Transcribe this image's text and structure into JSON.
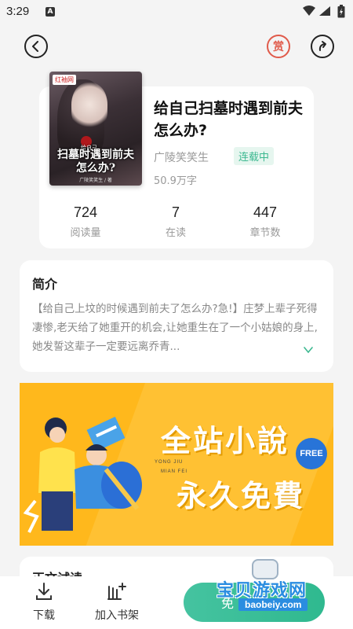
{
  "statusbar": {
    "time": "3:29"
  },
  "book": {
    "title": "给自己扫墓时遇到前夫怎么办?",
    "author": "广陵笑笑生",
    "status": "连载中",
    "words": "50.9万字",
    "reward_label": "赏",
    "cover": {
      "badge": "红袖网",
      "small_text": "给自己",
      "title": "扫墓时遇到前夫怎么办?",
      "sub": "广陵笑笑生 / 著"
    }
  },
  "stats": [
    {
      "value": "724",
      "label": "阅读量"
    },
    {
      "value": "7",
      "label": "在读"
    },
    {
      "value": "447",
      "label": "章节数"
    }
  ],
  "intro": {
    "heading": "简介",
    "text": "【给自己上坟的时候遇到前夫了怎么办?急!】庄梦上辈子死得凄惨,老天给了她重开的机会,让她重生在了一个小姑娘的身上,她发誓这辈子一定要远离乔青..."
  },
  "banner": {
    "line1": "全站小說",
    "line2": "永久免費",
    "free_badge": "FREE",
    "tiny1": "YONG JIU",
    "tiny2": "MIAN FEI"
  },
  "filter_section": {
    "heading": "正文试读"
  },
  "bottombar": {
    "download_label": "下载",
    "shelf_label": "加入书架",
    "read_label": "免"
  },
  "watermark": {
    "text": "宝贝游戏网",
    "url": "baobeiy.com"
  },
  "colors": {
    "accent": "#3cb890",
    "banner": "#ffb81c",
    "reward": "#e05a4a"
  }
}
